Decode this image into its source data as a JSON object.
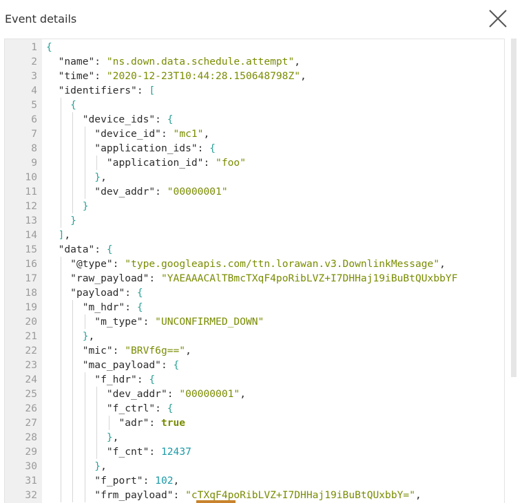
{
  "header": {
    "title": "Event details",
    "close_icon": "close-icon"
  },
  "editor": {
    "lines": [
      {
        "n": "1",
        "indent": 0,
        "parts": [
          [
            "brace",
            "{"
          ]
        ]
      },
      {
        "n": "2",
        "indent": 1,
        "parts": [
          [
            "key",
            "\"name\""
          ],
          [
            "punct",
            ": "
          ],
          [
            "str",
            "\"ns.down.data.schedule.attempt\""
          ],
          [
            "punct",
            ","
          ]
        ]
      },
      {
        "n": "3",
        "indent": 1,
        "parts": [
          [
            "key",
            "\"time\""
          ],
          [
            "punct",
            ": "
          ],
          [
            "str",
            "\"2020-12-23T10:44:28.150648798Z\""
          ],
          [
            "punct",
            ","
          ]
        ]
      },
      {
        "n": "4",
        "indent": 1,
        "parts": [
          [
            "key",
            "\"identifiers\""
          ],
          [
            "punct",
            ": "
          ],
          [
            "brace",
            "["
          ]
        ]
      },
      {
        "n": "5",
        "indent": 2,
        "parts": [
          [
            "brace",
            "{"
          ]
        ]
      },
      {
        "n": "6",
        "indent": 3,
        "parts": [
          [
            "key",
            "\"device_ids\""
          ],
          [
            "punct",
            ": "
          ],
          [
            "brace",
            "{"
          ]
        ]
      },
      {
        "n": "7",
        "indent": 4,
        "parts": [
          [
            "key",
            "\"device_id\""
          ],
          [
            "punct",
            ": "
          ],
          [
            "str",
            "\"mc1\""
          ],
          [
            "punct",
            ","
          ]
        ]
      },
      {
        "n": "8",
        "indent": 4,
        "parts": [
          [
            "key",
            "\"application_ids\""
          ],
          [
            "punct",
            ": "
          ],
          [
            "brace",
            "{"
          ]
        ]
      },
      {
        "n": "9",
        "indent": 5,
        "parts": [
          [
            "key",
            "\"application_id\""
          ],
          [
            "punct",
            ": "
          ],
          [
            "str",
            "\"foo\""
          ]
        ]
      },
      {
        "n": "10",
        "indent": 4,
        "parts": [
          [
            "brace",
            "}"
          ],
          [
            "punct",
            ","
          ]
        ]
      },
      {
        "n": "11",
        "indent": 4,
        "parts": [
          [
            "key",
            "\"dev_addr\""
          ],
          [
            "punct",
            ": "
          ],
          [
            "str",
            "\"00000001\""
          ]
        ]
      },
      {
        "n": "12",
        "indent": 3,
        "parts": [
          [
            "brace",
            "}"
          ]
        ]
      },
      {
        "n": "13",
        "indent": 2,
        "parts": [
          [
            "brace",
            "}"
          ]
        ]
      },
      {
        "n": "14",
        "indent": 1,
        "parts": [
          [
            "brace",
            "]"
          ],
          [
            "punct",
            ","
          ]
        ]
      },
      {
        "n": "15",
        "indent": 1,
        "parts": [
          [
            "key",
            "\"data\""
          ],
          [
            "punct",
            ": "
          ],
          [
            "brace",
            "{"
          ]
        ]
      },
      {
        "n": "16",
        "indent": 2,
        "parts": [
          [
            "key",
            "\"@type\""
          ],
          [
            "punct",
            ": "
          ],
          [
            "str",
            "\"type.googleapis.com/ttn.lorawan.v3.DownlinkMessage\""
          ],
          [
            "punct",
            ","
          ]
        ]
      },
      {
        "n": "17",
        "indent": 2,
        "parts": [
          [
            "key",
            "\"raw_payload\""
          ],
          [
            "punct",
            ": "
          ],
          [
            "str",
            "\"YAEAAACAlTBmcTXqF4poRibLVZ+I7DHHaj19iBuBtQUxbbYF"
          ]
        ]
      },
      {
        "n": "18",
        "indent": 2,
        "parts": [
          [
            "key",
            "\"payload\""
          ],
          [
            "punct",
            ": "
          ],
          [
            "brace",
            "{"
          ]
        ]
      },
      {
        "n": "19",
        "indent": 3,
        "parts": [
          [
            "key",
            "\"m_hdr\""
          ],
          [
            "punct",
            ": "
          ],
          [
            "brace",
            "{"
          ]
        ]
      },
      {
        "n": "20",
        "indent": 4,
        "parts": [
          [
            "key",
            "\"m_type\""
          ],
          [
            "punct",
            ": "
          ],
          [
            "str",
            "\"UNCONFIRMED_DOWN\""
          ]
        ]
      },
      {
        "n": "21",
        "indent": 3,
        "parts": [
          [
            "brace",
            "}"
          ],
          [
            "punct",
            ","
          ]
        ]
      },
      {
        "n": "22",
        "indent": 3,
        "parts": [
          [
            "key",
            "\"mic\""
          ],
          [
            "punct",
            ": "
          ],
          [
            "str",
            "\"BRVf6g==\""
          ],
          [
            "punct",
            ","
          ]
        ]
      },
      {
        "n": "23",
        "indent": 3,
        "parts": [
          [
            "key",
            "\"mac_payload\""
          ],
          [
            "punct",
            ": "
          ],
          [
            "brace",
            "{"
          ]
        ]
      },
      {
        "n": "24",
        "indent": 4,
        "parts": [
          [
            "key",
            "\"f_hdr\""
          ],
          [
            "punct",
            ": "
          ],
          [
            "brace",
            "{"
          ]
        ]
      },
      {
        "n": "25",
        "indent": 5,
        "parts": [
          [
            "key",
            "\"dev_addr\""
          ],
          [
            "punct",
            ": "
          ],
          [
            "str",
            "\"00000001\""
          ],
          [
            "punct",
            ","
          ]
        ]
      },
      {
        "n": "26",
        "indent": 5,
        "parts": [
          [
            "key",
            "\"f_ctrl\""
          ],
          [
            "punct",
            ": "
          ],
          [
            "brace",
            "{"
          ]
        ]
      },
      {
        "n": "27",
        "indent": 6,
        "parts": [
          [
            "key",
            "\"adr\""
          ],
          [
            "punct",
            ": "
          ],
          [
            "bool",
            "true"
          ]
        ]
      },
      {
        "n": "28",
        "indent": 5,
        "parts": [
          [
            "brace",
            "}"
          ],
          [
            "punct",
            ","
          ]
        ]
      },
      {
        "n": "29",
        "indent": 5,
        "parts": [
          [
            "key",
            "\"f_cnt\""
          ],
          [
            "punct",
            ": "
          ],
          [
            "num",
            "12437"
          ]
        ]
      },
      {
        "n": "30",
        "indent": 4,
        "parts": [
          [
            "brace",
            "}"
          ],
          [
            "punct",
            ","
          ]
        ]
      },
      {
        "n": "31",
        "indent": 4,
        "parts": [
          [
            "key",
            "\"f_port\""
          ],
          [
            "punct",
            ": "
          ],
          [
            "num",
            "102"
          ],
          [
            "punct",
            ","
          ]
        ]
      },
      {
        "n": "32",
        "indent": 4,
        "parts": [
          [
            "key",
            "\"frm_payload\""
          ],
          [
            "punct",
            ": "
          ],
          [
            "str",
            "\"cTXqF4poRibLVZ+I7DHHaj19iBuBtQUxbbY=\""
          ],
          [
            "punct",
            ","
          ]
        ]
      }
    ]
  },
  "colors": {
    "string": "#7a8c00",
    "number": "#1a9aa6",
    "brace": "#2aa198",
    "gutter_bg": "#f0f0f0",
    "line_number": "#9a9a9a"
  }
}
